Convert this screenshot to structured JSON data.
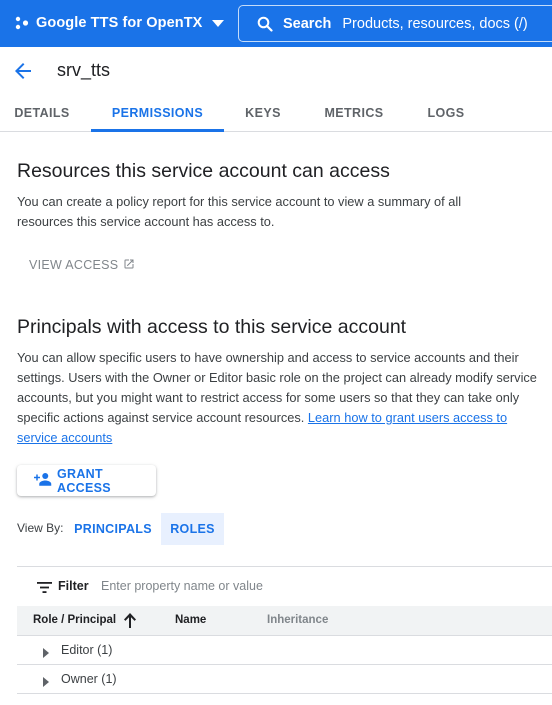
{
  "header": {
    "project_name": "Google TTS for OpenTX",
    "search_label": "Search",
    "search_placeholder": "Products, resources, docs (/)"
  },
  "page": {
    "title": "srv_tts"
  },
  "tabs": [
    {
      "label": "DETAILS",
      "active": false
    },
    {
      "label": "PERMISSIONS",
      "active": true
    },
    {
      "label": "KEYS",
      "active": false
    },
    {
      "label": "METRICS",
      "active": false
    },
    {
      "label": "LOGS",
      "active": false
    }
  ],
  "resources": {
    "heading": "Resources this service account can access",
    "description": "You can create a policy report for this service account to view a summary of all resources this service account has access to.",
    "view_access_label": "VIEW ACCESS"
  },
  "principals": {
    "heading": "Principals with access to this service account",
    "description": "You can allow specific users to have ownership and access to service accounts and their settings. Users with the Owner or Editor basic role on the project can already modify service accounts, but you might want to restrict access for some users so that they can take only specific actions against service account resources.",
    "learn_link": "Learn how to grant users access to service accounts",
    "grant_access_label": "GRANT ACCESS",
    "view_by_label": "View By:",
    "view_by_options": [
      {
        "label": "PRINCIPALS",
        "active": false
      },
      {
        "label": "ROLES",
        "active": true
      }
    ]
  },
  "table": {
    "filter_label": "Filter",
    "filter_placeholder": "Enter property name or value",
    "columns": [
      "Role / Principal",
      "Name",
      "Inheritance"
    ],
    "sort": "ascending",
    "rows": [
      {
        "label": "Editor (1)",
        "expanded": false
      },
      {
        "label": "Owner (1)",
        "expanded": false
      }
    ]
  },
  "colors": {
    "accent": "#1a73e8",
    "header_bg": "#1a73e8",
    "selected_bg": "#e8f0fe"
  },
  "icons": [
    "project-picker-icon",
    "caret-down-icon",
    "search-icon",
    "arrow-back-icon",
    "open-in-new-icon",
    "person-add-icon",
    "filter-icon",
    "arrow-upward-icon",
    "triangle-right-icon"
  ]
}
